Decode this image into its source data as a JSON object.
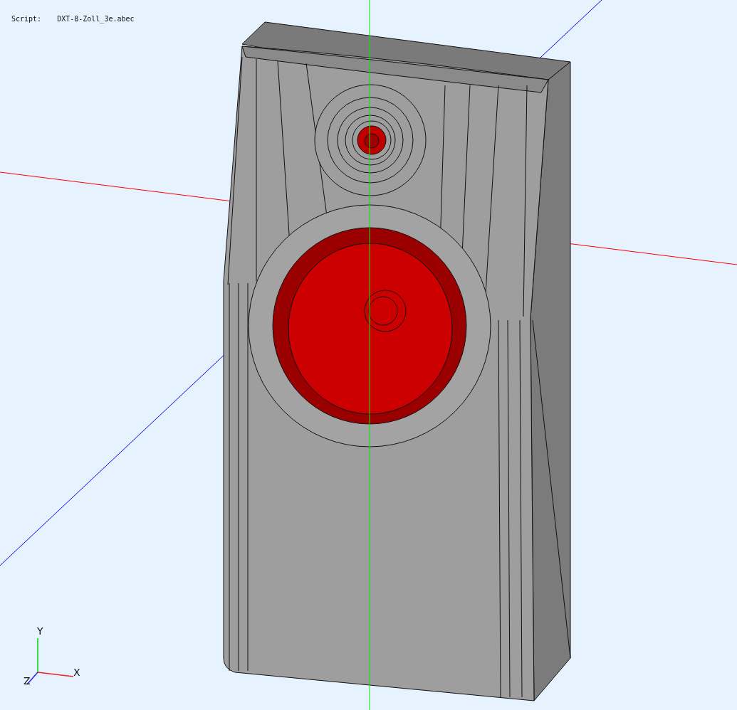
{
  "script": {
    "label": "Script:",
    "file": "DXT-8-Zoll_3e.abec"
  },
  "axes": [
    {
      "kind": "y",
      "label": "Y"
    },
    {
      "kind": "x",
      "label": "X"
    },
    {
      "kind": "z",
      "label": "Z"
    }
  ]
}
